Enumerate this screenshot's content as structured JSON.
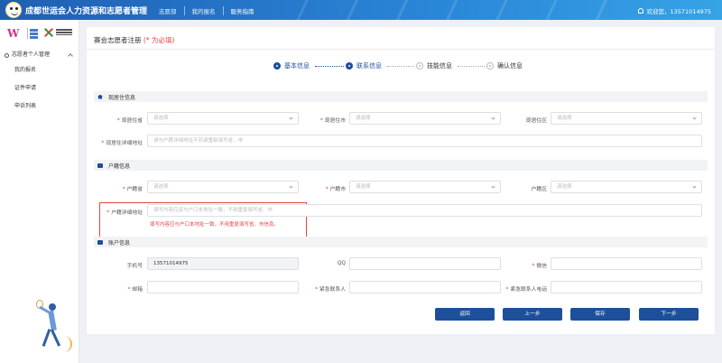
{
  "header": {
    "title": "成都世运会人力资源和志愿者管理",
    "nav": [
      "志愿部",
      "我的报名",
      "服务指南"
    ],
    "user_greeting": "欢迎您，13571014975"
  },
  "sidebar": {
    "group_label": "志愿者个人管理",
    "items": [
      "我的报名",
      "证件申请",
      "申诉列表"
    ]
  },
  "page": {
    "title": "赛会志愿者注册",
    "required_note": "(* 为必填)"
  },
  "steps": [
    {
      "label": "基本信息",
      "state": "done"
    },
    {
      "label": "联系信息",
      "state": "active"
    },
    {
      "label": "技能信息",
      "state": "todo"
    },
    {
      "label": "确认信息",
      "state": "todo"
    }
  ],
  "residence": {
    "section_title": "现居住信息",
    "province_label": "现居住省",
    "city_label": "现居住市",
    "district_label": "现居住区",
    "address_label": "现居住详细地址",
    "select_placeholder": "请选择",
    "address_placeholder": "请与户籍详细地址不同请重新填写省、市"
  },
  "household": {
    "section_title": "户籍信息",
    "province_label": "户籍省",
    "city_label": "户籍市",
    "district_label": "户籍区",
    "address_label": "户籍详细地址",
    "select_placeholder": "请选择",
    "address_placeholder": "填写内容应该与户口本地址一致，不用重复填写省、市",
    "hint": "填写内容应与户口本地址一致，不用重复填写省、市信息。"
  },
  "account": {
    "section_title": "账户信息",
    "phone_label": "手机号",
    "phone_value": "13571014975",
    "qq_label": "QQ",
    "wechat_label": "微信",
    "email_label": "邮箱",
    "emergency_contact_label": "紧急联系人",
    "emergency_phone_label": "紧急联系人电话"
  },
  "buttons": {
    "back": "返回",
    "prev": "上一步",
    "save": "保存",
    "next": "下一步"
  },
  "colors": {
    "primary": "#1d4f9a",
    "header_start": "#1f5fb3",
    "header_end": "#36a3e6",
    "required": "#e64545"
  }
}
